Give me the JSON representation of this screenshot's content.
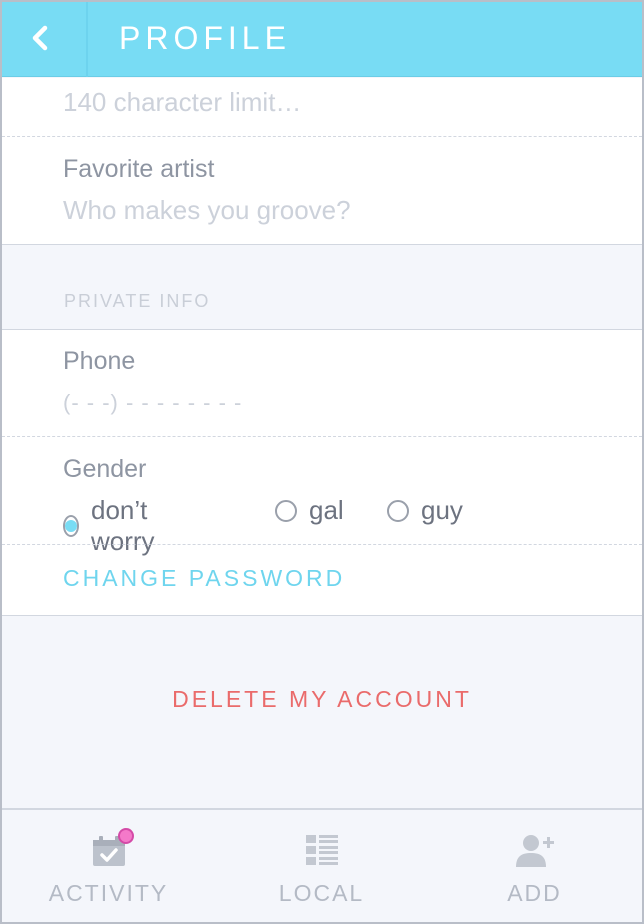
{
  "header": {
    "title": "PROFILE"
  },
  "bio": {
    "placeholder": "140 character limit…"
  },
  "favorite_artist": {
    "label": "Favorite artist",
    "placeholder": "Who makes you groove?"
  },
  "private_info": {
    "header": "PRIVATE INFO"
  },
  "phone": {
    "label": "Phone",
    "placeholder": "(- - -) - - -  -  - - - -"
  },
  "gender": {
    "label": "Gender",
    "options": [
      "don’t worry",
      "gal",
      "guy"
    ],
    "selected": "don’t worry"
  },
  "actions": {
    "change_password": "CHANGE PASSWORD",
    "delete_account": "DELETE MY ACCOUNT"
  },
  "tabbar": {
    "tabs": [
      {
        "label": "ACTIVITY",
        "icon": "calendar-check-icon"
      },
      {
        "label": "LOCAL",
        "icon": "list-icon"
      },
      {
        "label": "ADD",
        "icon": "add-user-icon"
      }
    ]
  },
  "colors": {
    "accent": "#78dcf4",
    "danger": "#ea6b6b",
    "notification": "#f479c9"
  }
}
